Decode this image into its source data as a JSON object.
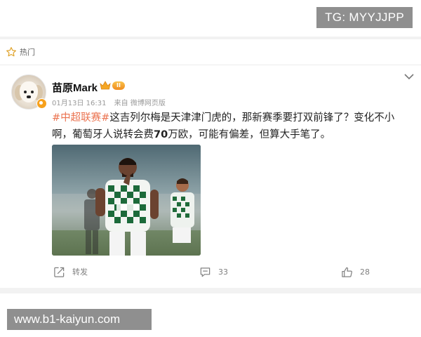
{
  "watermark_top": "TG: MYYJJPP",
  "section": {
    "label": "热门",
    "icon": "star-icon"
  },
  "post": {
    "username": "苗原Mark",
    "level": "II",
    "date": "01月13日 16:31",
    "source": "来自 微博网页版",
    "topic": "#中超联赛#",
    "text_part1": "这吉列尔梅是天津津门虎的，那新赛季要打双前锋了？变化不小啊，葡萄牙人说转会费",
    "text_bold": "70",
    "text_part2": "万欧，可能有偏差，但算大手笔了。",
    "image_alt": "football-player-photo"
  },
  "actions": {
    "repost_label": "转发",
    "comment_count": "33",
    "like_count": "28"
  },
  "watermark_bottom": "www.b1-kaiyun.com",
  "colors": {
    "topic": "#eb7350",
    "badge": "#8f8f8f",
    "verified": "#f7a11c"
  }
}
